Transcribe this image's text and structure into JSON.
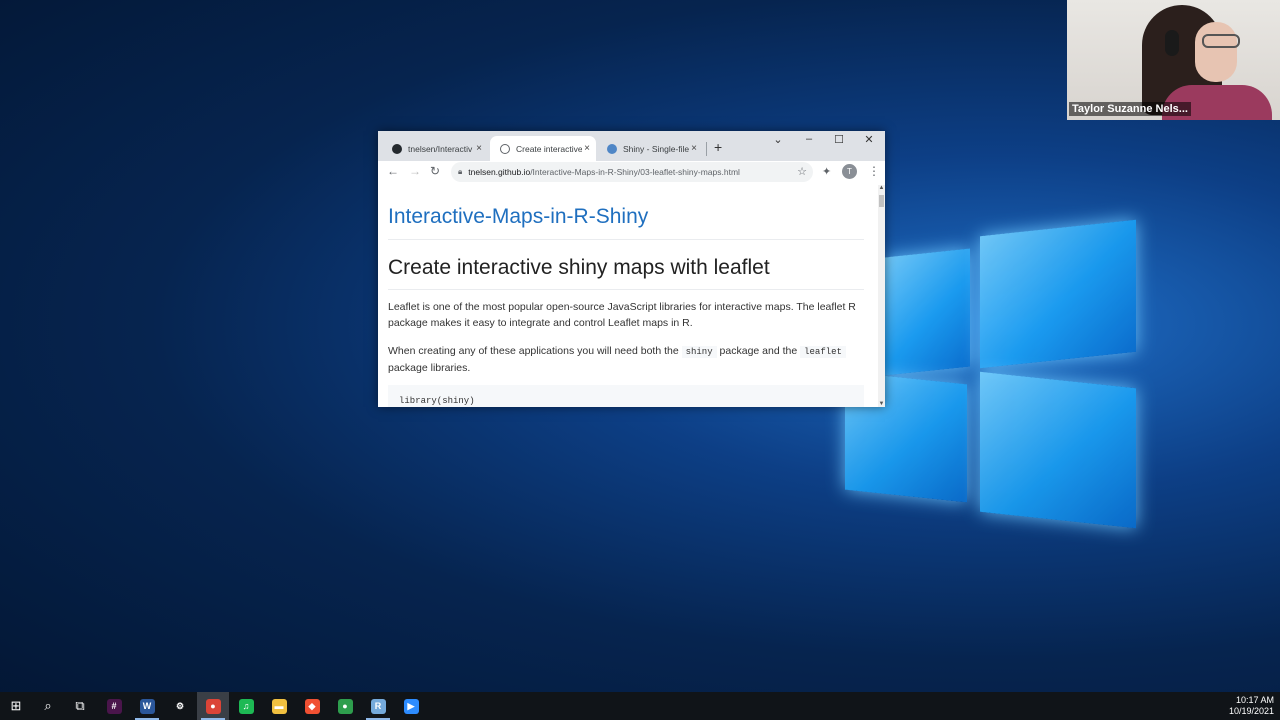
{
  "video_call": {
    "participant_name": "Taylor Suzanne Nels..."
  },
  "browser": {
    "tabs": [
      {
        "label": "tnelsen/Interactiv",
        "close": "×",
        "icon_color": "#24292e"
      },
      {
        "label": "Create interactive",
        "close": "×",
        "icon_color": "#5f6368"
      },
      {
        "label": "Shiny - Single-file",
        "close": "×",
        "icon_color": "#4f86c6"
      }
    ],
    "new_tab": "+",
    "window_controls": {
      "tab_search": "⌄",
      "minimize": "–",
      "maximize": "☐",
      "close": "✕"
    },
    "toolbar": {
      "back": "←",
      "forward": "→",
      "reload": "↻",
      "url_host": "tnelsen.github.io",
      "url_path": "/Interactive-Maps-in-R-Shiny/03-leaflet-shiny-maps.html",
      "bookmark_star": "☆",
      "extensions": "✦",
      "profile_initial": "T",
      "menu": "⋮"
    },
    "page": {
      "site_title": "Interactive-Maps-in-R-Shiny",
      "heading": "Create interactive shiny maps with leaflet",
      "para1": "Leaflet is one of the most popular open-source JavaScript libraries for interactive maps. The leaflet R package makes it easy to integrate and control Leaflet maps in R.",
      "para2_prefix": "When creating any of these applications you will need both the",
      "para2_code1": "shiny",
      "para2_mid": "package and the",
      "para2_code2": "leaflet",
      "para2_suffix": "package libraries.",
      "code_line1": "library(shiny)"
    }
  },
  "taskbar": {
    "start": "⊞",
    "search": "⌕",
    "task_view": "⧉",
    "apps": [
      {
        "name": "slack",
        "glyph": "#",
        "color": "#4a154b"
      },
      {
        "name": "word",
        "glyph": "W",
        "color": "#2b579a"
      },
      {
        "name": "settings",
        "glyph": "⚙",
        "color": "#101418"
      },
      {
        "name": "chrome",
        "glyph": "●",
        "color": "#db4437"
      },
      {
        "name": "spotify",
        "glyph": "♫",
        "color": "#1db954"
      },
      {
        "name": "file-explorer",
        "glyph": "▬",
        "color": "#f0c040"
      },
      {
        "name": "git",
        "glyph": "◆",
        "color": "#f05032"
      },
      {
        "name": "app-green",
        "glyph": "●",
        "color": "#2e9e4d"
      },
      {
        "name": "rstudio",
        "glyph": "R",
        "color": "#75aadb"
      },
      {
        "name": "zoom",
        "glyph": "▶",
        "color": "#2d8cff"
      }
    ],
    "time": "10:17 AM",
    "date": "10/19/2021"
  }
}
